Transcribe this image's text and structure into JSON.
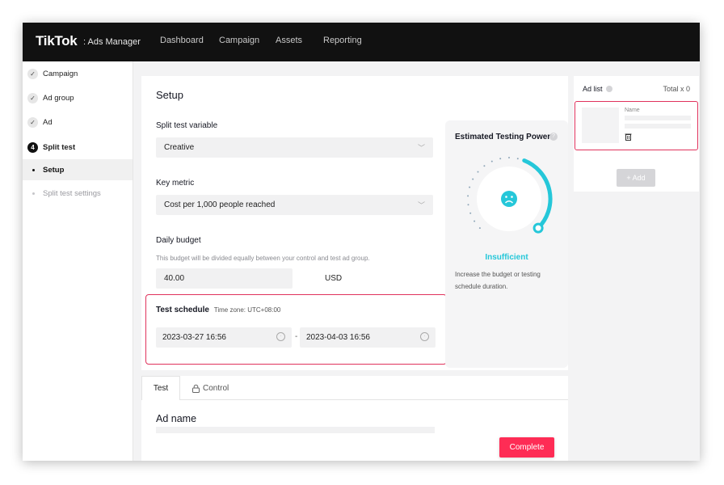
{
  "topbar": {
    "brand": "TikTok",
    "brand_sub": ": Ads Manager",
    "nav": [
      "Dashboard",
      "Campaign",
      "Assets",
      "Reporting"
    ]
  },
  "sidebar": {
    "steps": [
      {
        "label": "Campaign",
        "state": "done"
      },
      {
        "label": "Ad group",
        "state": "done"
      },
      {
        "label": "Ad",
        "state": "done"
      },
      {
        "label": "Split test",
        "state": "current",
        "number": "4"
      }
    ],
    "subitems": [
      {
        "label": "Setup",
        "active": true
      },
      {
        "label": "Split test settings",
        "active": false
      }
    ]
  },
  "setup": {
    "title": "Setup",
    "variable_label": "Split test variable",
    "variable_value": "Creative",
    "metric_label": "Key metric",
    "metric_value": "Cost per 1,000 people reached",
    "budget_label": "Daily budget",
    "budget_help": "This budget will be divided equally between your control and test ad group.",
    "budget_value": "40.00",
    "budget_currency": "USD",
    "schedule_label": "Test schedule",
    "schedule_timezone": "Time zone: UTC+08:00",
    "start": "2023-03-27 16:56",
    "end": "2023-04-03 16:56",
    "separator": "-"
  },
  "power": {
    "title": "Estimated Testing Power",
    "status": "Insufficient",
    "help": [
      "Increase the budget or testing",
      "schedule duration."
    ],
    "level": 0.42
  },
  "tabs": {
    "test": "Test",
    "control": "Control"
  },
  "ad_name_title": "Ad name",
  "complete_label": "Complete",
  "adlist": {
    "title": "Ad list",
    "total": "Total x 0",
    "name_label": "Name",
    "add_label": "+ Add"
  },
  "colors": {
    "accent": "#fe2c55",
    "highlight": "#e0325c",
    "power": "#25c7d9"
  }
}
